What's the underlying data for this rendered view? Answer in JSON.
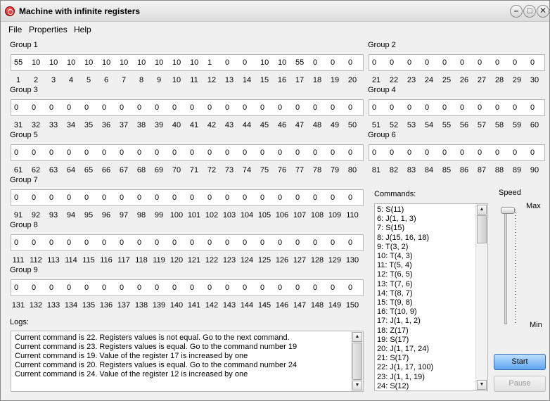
{
  "window": {
    "title": "Machine with infinite registers",
    "minimize": "–",
    "maximize": "□",
    "close": "✕"
  },
  "menu": [
    "File",
    "Properties",
    "Help"
  ],
  "groups": [
    {
      "label": "Group 1",
      "start": 1,
      "values": [
        55,
        10,
        10,
        10,
        10,
        10,
        10,
        10,
        10,
        10,
        10,
        1,
        0,
        0,
        10,
        10,
        55,
        0,
        0,
        0
      ]
    },
    {
      "label": "Group 2",
      "start": 21,
      "values": [
        0,
        0,
        0,
        0,
        0,
        0,
        0,
        0,
        0,
        0
      ]
    },
    {
      "label": "Group 3",
      "start": 31,
      "values": [
        0,
        0,
        0,
        0,
        0,
        0,
        0,
        0,
        0,
        0,
        0,
        0,
        0,
        0,
        0,
        0,
        0,
        0,
        0,
        0
      ]
    },
    {
      "label": "Group 4",
      "start": 51,
      "values": [
        0,
        0,
        0,
        0,
        0,
        0,
        0,
        0,
        0,
        0
      ]
    },
    {
      "label": "Group 5",
      "start": 61,
      "values": [
        0,
        0,
        0,
        0,
        0,
        0,
        0,
        0,
        0,
        0,
        0,
        0,
        0,
        0,
        0,
        0,
        0,
        0,
        0,
        0
      ]
    },
    {
      "label": "Group 6",
      "start": 81,
      "values": [
        0,
        0,
        0,
        0,
        0,
        0,
        0,
        0,
        0,
        0
      ]
    },
    {
      "label": "Group 7",
      "start": 91,
      "values": [
        0,
        0,
        0,
        0,
        0,
        0,
        0,
        0,
        0,
        0,
        0,
        0,
        0,
        0,
        0,
        0,
        0,
        0,
        0,
        0
      ]
    },
    {
      "label": "Group 8",
      "start": 111,
      "values": [
        0,
        0,
        0,
        0,
        0,
        0,
        0,
        0,
        0,
        0,
        0,
        0,
        0,
        0,
        0,
        0,
        0,
        0,
        0,
        0
      ]
    },
    {
      "label": "Group 9",
      "start": 131,
      "values": [
        0,
        0,
        0,
        0,
        0,
        0,
        0,
        0,
        0,
        0,
        0,
        0,
        0,
        0,
        0,
        0,
        0,
        0,
        0,
        0
      ]
    }
  ],
  "logs": {
    "label": "Logs:",
    "lines": [
      "Current command is 22. Registers values is not equal. Go to the next command.",
      "Current command is 23. Registers values is equal. Go to the command number 19",
      "Current command is 19. Value of the register  17 is increased by one",
      "Current command is 20. Registers values is equal. Go to the command number 24",
      "Current command is 24. Value of the register  12 is increased by one"
    ]
  },
  "commands": {
    "label": "Commands:",
    "items": [
      "5: S(11)",
      "6: J(1, 1, 3)",
      "7: S(15)",
      "8: J(15, 16, 18)",
      "9: T(3, 2)",
      "10: T(4, 3)",
      "11: T(5, 4)",
      "12: T(6, 5)",
      "13: T(7, 6)",
      "14: T(8, 7)",
      "15: T(9, 8)",
      "16: T(10, 9)",
      "17: J(1, 1, 2)",
      "18: Z(17)",
      "19: S(17)",
      "20: J(1, 17, 24)",
      "21: S(17)",
      "22: J(1, 17, 100)",
      "23: J(1, 1, 19)",
      "24: S(12)"
    ]
  },
  "speed": {
    "label": "Speed",
    "max": "Max",
    "min": "Min",
    "level": 1.0
  },
  "buttons": {
    "start": "Start",
    "pause": "Pause"
  },
  "scroll": {
    "up": "▲",
    "down": "▼"
  },
  "colors": {
    "start_button": "#6aaef0",
    "window_bg": "#f0f0f0"
  }
}
